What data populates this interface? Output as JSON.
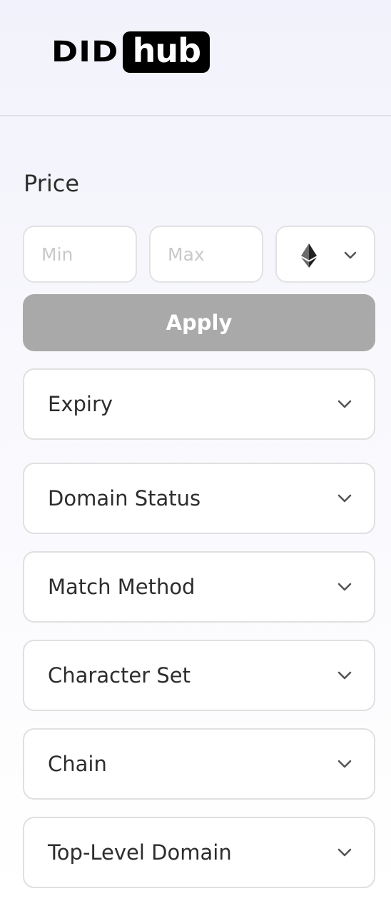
{
  "logo": {
    "part1": "DID",
    "part2": "hub"
  },
  "price": {
    "title": "Price",
    "min_placeholder": "Min",
    "max_placeholder": "Max",
    "currency_icon": "ethereum-icon",
    "apply_label": "Apply"
  },
  "filters": [
    {
      "label": "Expiry"
    },
    {
      "label": "Domain Status"
    },
    {
      "label": "Match Method"
    },
    {
      "label": "Character Set"
    },
    {
      "label": "Chain"
    },
    {
      "label": "Top-Level Domain"
    }
  ],
  "colors": {
    "apply_disabled_bg": "#a9a9a9",
    "border": "#e0e0e0",
    "text": "#2d2d2d",
    "placeholder": "#c9c9c9"
  }
}
